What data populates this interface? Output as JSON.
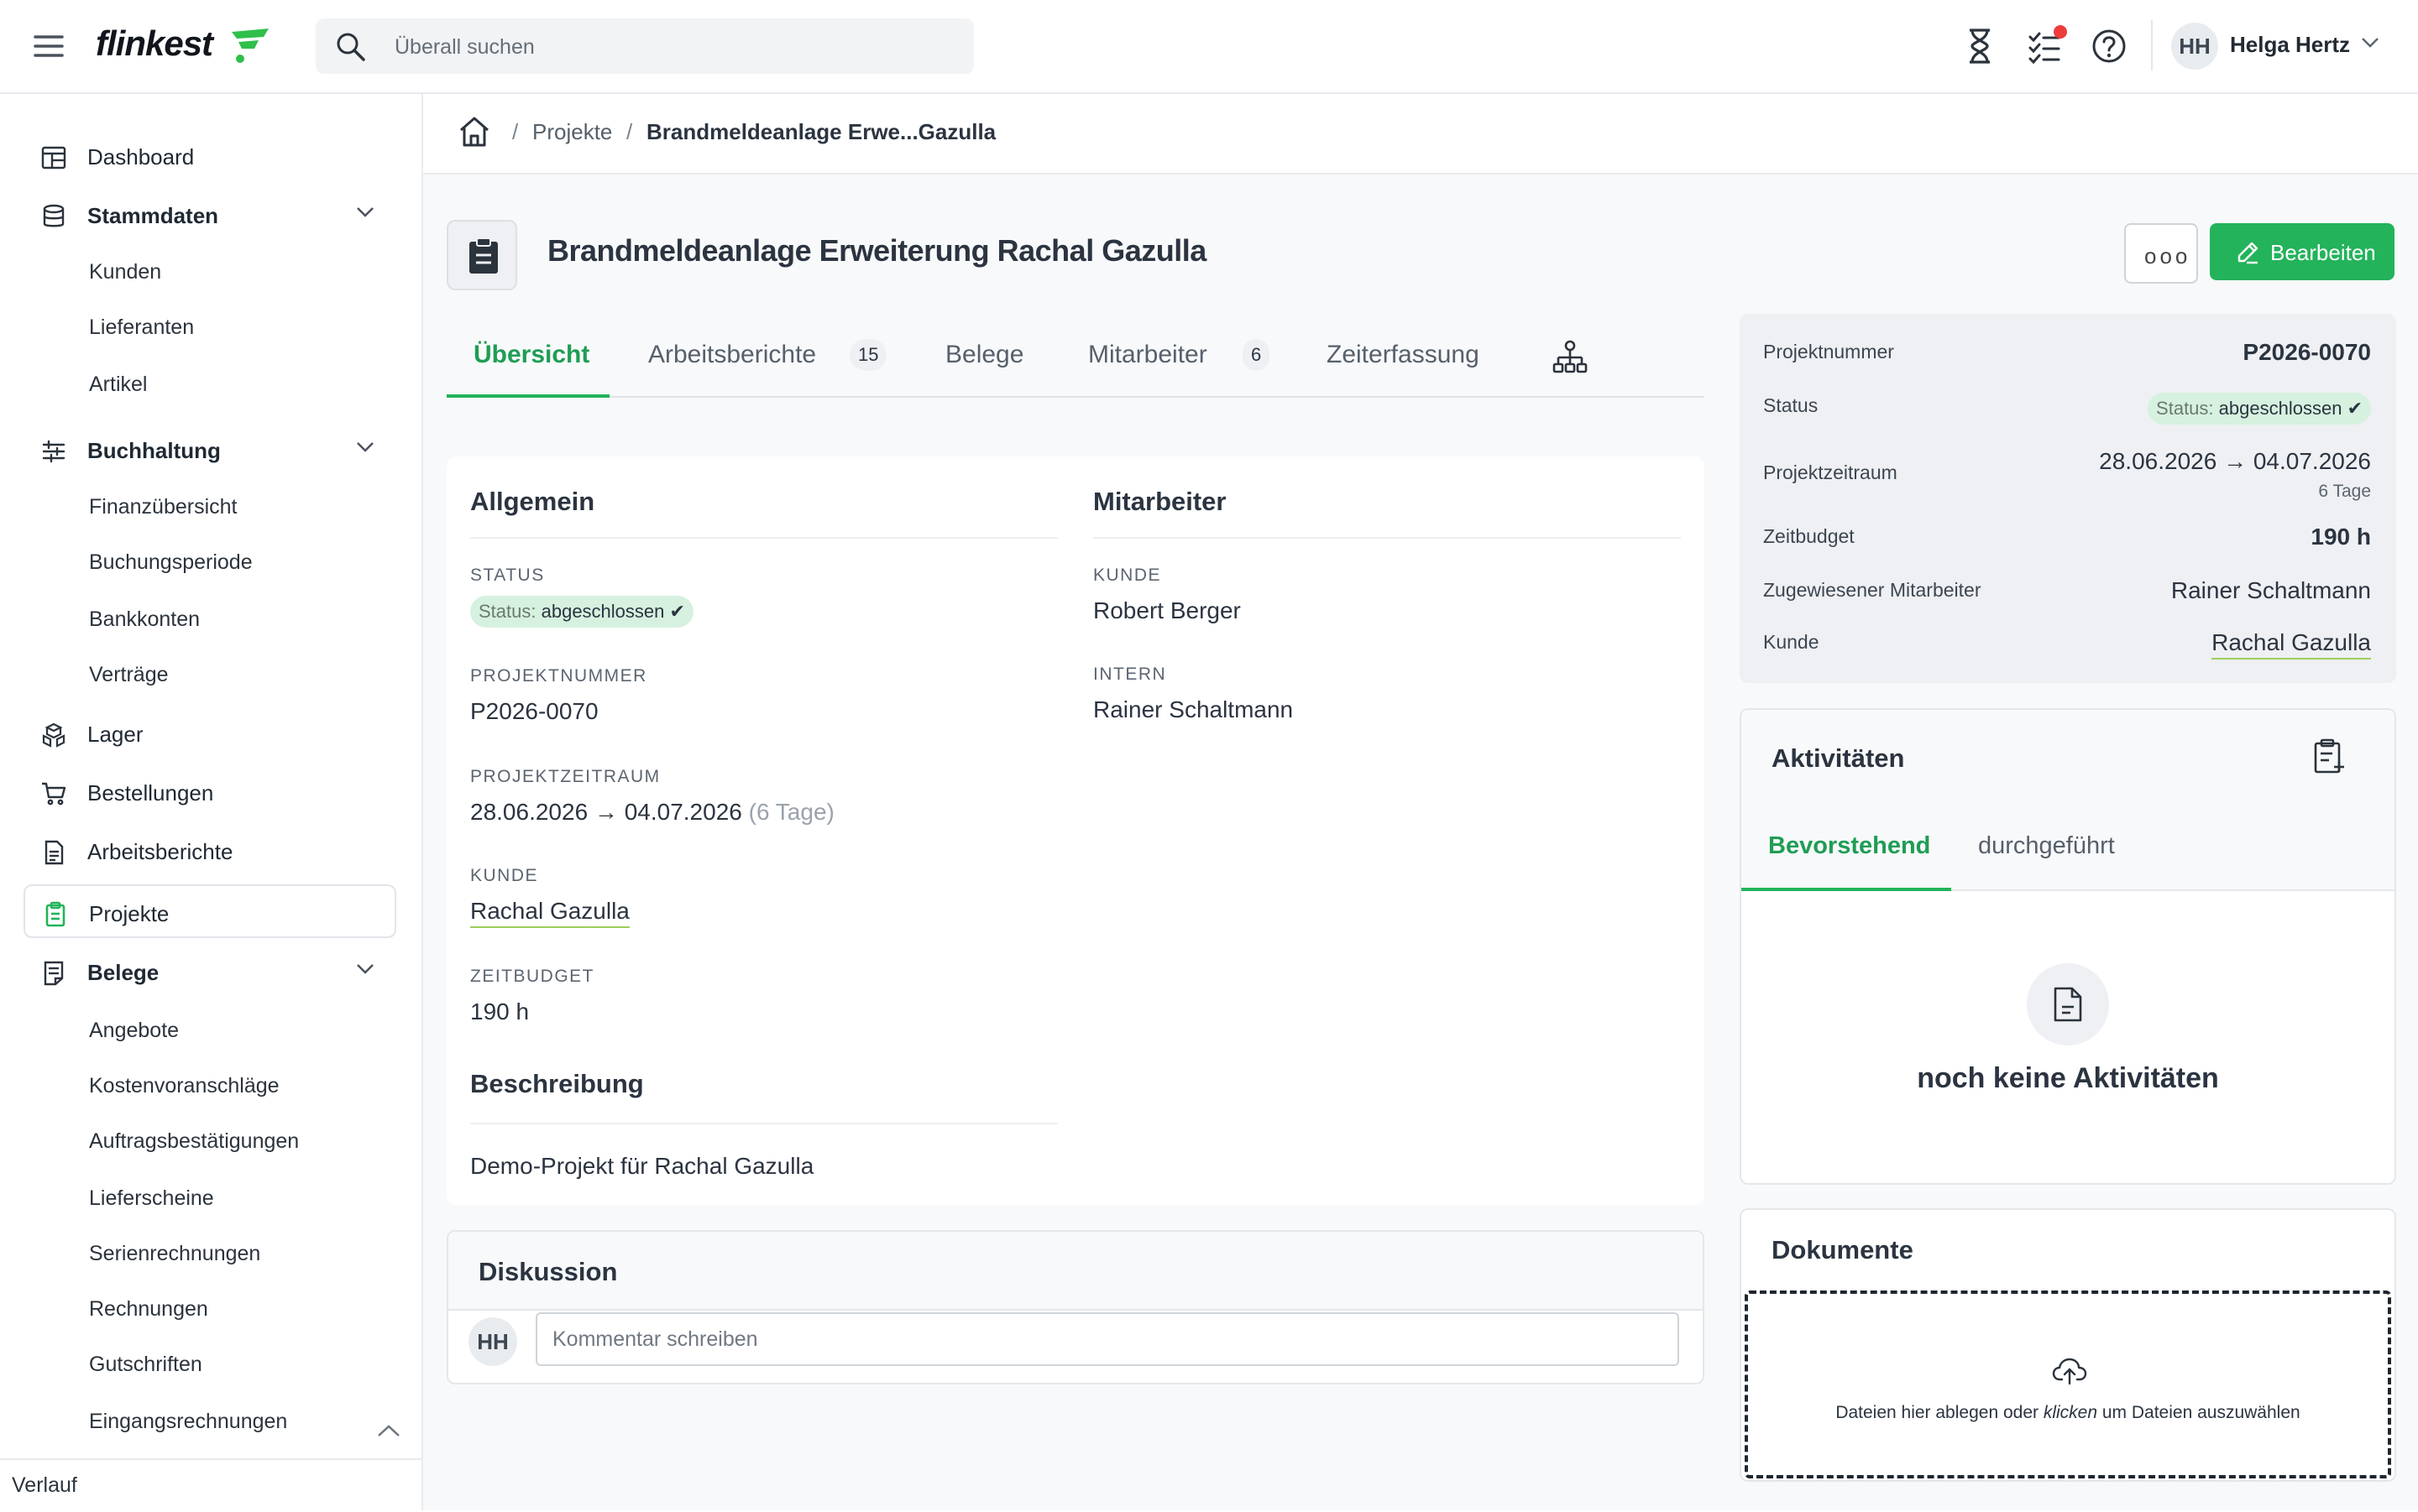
{
  "app": {
    "logo": "flinkest",
    "search_placeholder": "Überall suchen"
  },
  "topbar": {
    "user_initials": "HH",
    "user_name": "Helga Hertz",
    "icons": [
      "hourglass-icon",
      "tasks-icon",
      "help-icon",
      "chevron-down-icon"
    ],
    "notification_color": "#ee3b3b"
  },
  "sidebar": {
    "items": {
      "dashboard": "Dashboard",
      "stammdaten": "Stammdaten",
      "kunden": "Kunden",
      "lieferanten": "Lieferanten",
      "artikel": "Artikel",
      "buchhaltung": "Buchhaltung",
      "finanzuebersicht": "Finanzübersicht",
      "buchungsperiode": "Buchungsperiode",
      "bankkonten": "Bankkonten",
      "vertraege": "Verträge",
      "lager": "Lager",
      "bestellungen": "Bestellungen",
      "arbeitsberichte": "Arbeitsberichte",
      "projekte": "Projekte",
      "belege": "Belege",
      "angebote": "Angebote",
      "kostenvoranschlaege": "Kostenvoranschläge",
      "auftragsbestaetigungen": "Auftragsbestätigungen",
      "lieferscheine": "Lieferscheine",
      "serienrechnungen": "Serienrechnungen",
      "rechnungen": "Rechnungen",
      "gutschriften": "Gutschriften",
      "eingangsrechnungen": "Eingangsrechnungen"
    },
    "active": "Projekte",
    "verlauf": "Verlauf"
  },
  "breadcrumb": {
    "sep": "/",
    "parent": "Projekte",
    "current": "Brandmeldeanlage Erwe...Gazulla"
  },
  "page": {
    "title": "Brandmeldeanlage Erweiterung Rachal Gazulla",
    "more_label": "ooo",
    "edit_label": "Bearbeiten",
    "accent_color": "#23b35a"
  },
  "tabs": [
    {
      "label": "Übersicht",
      "active": true
    },
    {
      "label": "Arbeitsberichte",
      "badge": "15"
    },
    {
      "label": "Belege"
    },
    {
      "label": "Mitarbeiter",
      "badge": "6"
    },
    {
      "label": "Zeiterfassung"
    }
  ],
  "allgemein": {
    "title": "Allgemein",
    "status_label": "STATUS",
    "status_key": "Status:",
    "status_value": "abgeschlossen",
    "projektnummer_label": "PROJEKTNUMMER",
    "projektnummer": "P2026-0070",
    "zeitraum_label": "PROJEKTZEITRAUM",
    "zeitraum": "28.06.2026 → 04.07.2026",
    "zeitraum_days": "(6 Tage)",
    "kunde_label": "KUNDE",
    "kunde": "Rachal Gazulla",
    "zeitbudget_label": "ZEITBUDGET",
    "zeitbudget": "190 h"
  },
  "mitarbeiter": {
    "title": "Mitarbeiter",
    "kunde_label": "KUNDE",
    "kunde": "Robert Berger",
    "intern_label": "INTERN",
    "intern": "Rainer Schaltmann"
  },
  "beschreibung": {
    "title": "Beschreibung",
    "text": "Demo-Projekt für Rachal Gazulla"
  },
  "diskussion": {
    "title": "Diskussion",
    "avatar": "HH",
    "placeholder": "Kommentar schreiben"
  },
  "info_panel": {
    "projektnummer_label": "Projektnummer",
    "projektnummer": "P2026-0070",
    "status_label": "Status",
    "status_key": "Status:",
    "status_value": "abgeschlossen",
    "zeitraum_label": "Projektzeitraum",
    "zeitraum": "28.06.2026 → 04.07.2026",
    "zeitraum_days": "6 Tage",
    "zeitbudget_label": "Zeitbudget",
    "zeitbudget": "190 h",
    "mitarbeiter_label": "Zugewiesener Mitarbeiter",
    "mitarbeiter": "Rainer Schaltmann",
    "kunde_label": "Kunde",
    "kunde": "Rachal Gazulla"
  },
  "aktivitaeten": {
    "title": "Aktivitäten",
    "tabs": [
      {
        "label": "Bevorstehend",
        "active": true
      },
      {
        "label": "durchgeführt"
      }
    ],
    "empty": "noch keine Aktivitäten"
  },
  "dokumente": {
    "title": "Dokumente",
    "drop_before": "Dateien hier ablegen oder ",
    "drop_em": "klicken",
    "drop_after": " um Dateien auszuwählen"
  }
}
